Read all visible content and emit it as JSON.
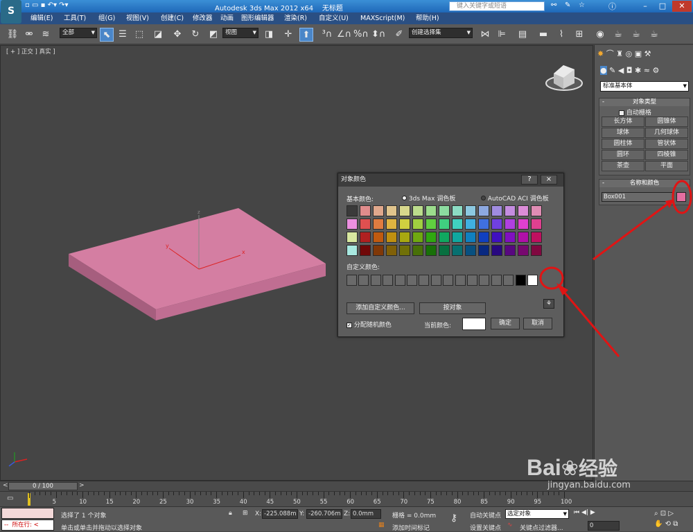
{
  "titlebar": {
    "app_title": "Autodesk 3ds Max  2012 x64",
    "doc_title": "无标题",
    "search_placeholder": "键入关键字或短语"
  },
  "menu": [
    "编辑(E)",
    "工具(T)",
    "组(G)",
    "视图(V)",
    "创建(C)",
    "修改器",
    "动画",
    "图形编辑器",
    "渲染(R)",
    "自定义(U)",
    "MAXScript(M)",
    "帮助(H)"
  ],
  "toolbar": {
    "filter_select": "全部",
    "ref_coord_select": "视图",
    "selection_set_select": "创建选择集"
  },
  "viewport": {
    "label": "[ + ] 正交 ] 真实 ]",
    "axis_x": "x",
    "axis_y": "y",
    "gizmo_z": "z"
  },
  "command_panel": {
    "category_select": "标准基本体",
    "object_type_title": "对象类型",
    "autogrid_label": "自动栅格",
    "object_buttons": [
      "长方体",
      "圆锥体",
      "球体",
      "几何球体",
      "圆柱体",
      "管状体",
      "圆环",
      "四棱锥",
      "茶壶",
      "平面"
    ],
    "name_color_title": "名称和颜色",
    "object_name": "Box001",
    "object_color": "#e46ea0"
  },
  "color_dialog": {
    "title": "对象颜色",
    "help_btn": "?",
    "close_btn": "×",
    "basic_colors_label": "基本颜色:",
    "palette_option_max": "3ds Max 调色板",
    "palette_option_aci": "AutoCAD ACI 调色板",
    "custom_colors_label": "自定义颜色:",
    "add_custom_btn": "添加自定义颜色...",
    "by_object_btn": "按对象",
    "random_color_label": "分配随机颜色",
    "current_color_label": "当前颜色:",
    "current_color": "#ffffff",
    "ok_btn": "确定",
    "cancel_btn": "取消",
    "palette_rows": [
      [
        "#3a3a3a",
        "#e08c8c",
        "#e0a88c",
        "#e0c48c",
        "#d8d88c",
        "#bcdc8c",
        "#9cdc8c",
        "#8cdca0",
        "#8cdcc4",
        "#8cc8e0",
        "#8ca8e0",
        "#a08ce0",
        "#c48ce0",
        "#dc8cd8",
        "#e08cb4"
      ],
      [
        "#ec90e0",
        "#e05050",
        "#e07c40",
        "#e0b440",
        "#d0d040",
        "#a0d040",
        "#60d040",
        "#40d080",
        "#40d0c0",
        "#40b0e0",
        "#4070e0",
        "#7040e0",
        "#b040e0",
        "#e040d0",
        "#e04090"
      ],
      [
        "#d8e8a0",
        "#b02020",
        "#c05a10",
        "#c09010",
        "#a8a810",
        "#70a810",
        "#30a810",
        "#10a860",
        "#10a8a0",
        "#1080c0",
        "#1040c0",
        "#4010c0",
        "#8010c0",
        "#b010a8",
        "#c01060"
      ],
      [
        "#a8e8e0",
        "#700808",
        "#803808",
        "#806008",
        "#707008",
        "#487008",
        "#187008",
        "#087040",
        "#087070",
        "#085080",
        "#082880",
        "#280880",
        "#580880",
        "#780870",
        "#800840"
      ]
    ],
    "custom_colors": [
      "#6a6a6a",
      "#6a6a6a",
      "#6a6a6a",
      "#6a6a6a",
      "#6a6a6a",
      "#6a6a6a",
      "#6a6a6a",
      "#6a6a6a",
      "#6a6a6a",
      "#6a6a6a",
      "#6a6a6a",
      "#6a6a6a",
      "#6a6a6a",
      "#6a6a6a",
      "#000000",
      "#ffffff"
    ]
  },
  "timeline": {
    "frame_counter": "0 / 100",
    "ticks": [
      "0",
      "5",
      "10",
      "15",
      "20",
      "25",
      "30",
      "35",
      "40",
      "45",
      "50",
      "55",
      "60",
      "65",
      "70",
      "75",
      "80",
      "85",
      "90",
      "95",
      "100"
    ]
  },
  "status": {
    "maxscript_label": "所在行:",
    "selection_info": "选择了 1 个对象",
    "prompt": "单击或单击并拖动以选择对象",
    "x_label": "X:",
    "x_value": "-225.088m",
    "y_label": "Y:",
    "y_value": "-260.706m",
    "z_label": "Z:",
    "z_value": "0.0mm",
    "grid_label": "栅格 = 0.0mm",
    "add_time_tag": "添加时间标记",
    "auto_key": "自动关键点",
    "set_key": "设置关键点",
    "selected_select": "选定对象",
    "key_filters": "关键点过滤器...",
    "frame_value": "0"
  },
  "watermark": {
    "brand": "Bai",
    "brand2": "经验",
    "url": "jingyan.baidu.com"
  },
  "colors": {
    "box": "#d27aa0",
    "annotation": "#e01414"
  }
}
